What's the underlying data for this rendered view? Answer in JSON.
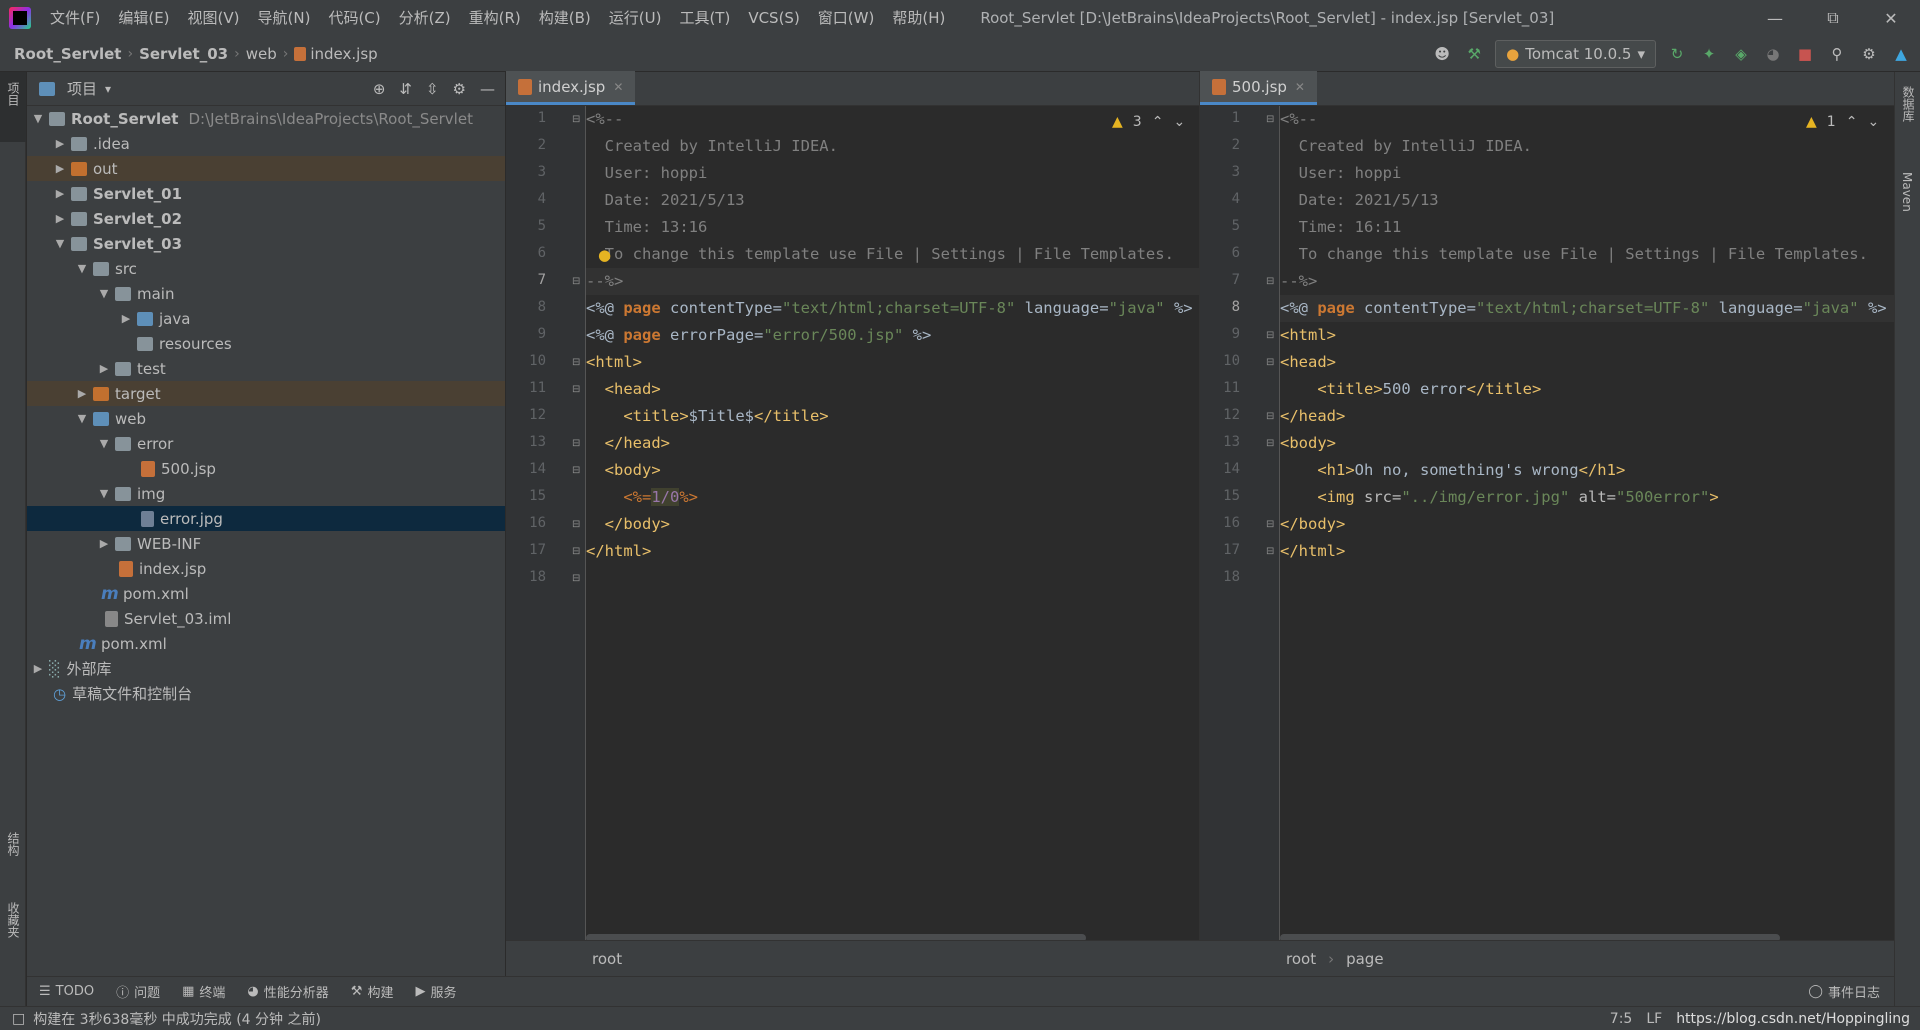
{
  "menu": [
    "文件(F)",
    "编辑(E)",
    "视图(V)",
    "导航(N)",
    "代码(C)",
    "分析(Z)",
    "重构(R)",
    "构建(B)",
    "运行(U)",
    "工具(T)",
    "VCS(S)",
    "窗口(W)",
    "帮助(H)"
  ],
  "window_title": "Root_Servlet [D:\\JetBrains\\IdeaProjects\\Root_Servlet] - index.jsp [Servlet_03]",
  "breadcrumb": [
    "Root_Servlet",
    "Servlet_03",
    "web",
    "index.jsp"
  ],
  "run_config": "Tomcat 10.0.5",
  "left_stripe": {
    "project": "项目",
    "structure": "结构",
    "favorites": "收藏夹"
  },
  "right_stripe": {
    "database": "数据库",
    "maven": "Maven"
  },
  "project_panel": {
    "title": "项目",
    "tree": [
      {
        "label": "Root_Servlet",
        "path": "D:\\JetBrains\\IdeaProjects\\Root_Servlet",
        "bold": true
      },
      {
        "label": ".idea"
      },
      {
        "label": "out"
      },
      {
        "label": "Servlet_01",
        "bold": true
      },
      {
        "label": "Servlet_02",
        "bold": true
      },
      {
        "label": "Servlet_03",
        "bold": true
      },
      {
        "label": "src"
      },
      {
        "label": "main"
      },
      {
        "label": "java"
      },
      {
        "label": "resources"
      },
      {
        "label": "test"
      },
      {
        "label": "target"
      },
      {
        "label": "web"
      },
      {
        "label": "error"
      },
      {
        "label": "500.jsp"
      },
      {
        "label": "img"
      },
      {
        "label": "error.jpg"
      },
      {
        "label": "WEB-INF"
      },
      {
        "label": "index.jsp"
      },
      {
        "label": "pom.xml"
      },
      {
        "label": "Servlet_03.iml"
      },
      {
        "label": "pom.xml"
      },
      {
        "label": "外部库"
      },
      {
        "label": "草稿文件和控制台"
      }
    ]
  },
  "editor_left": {
    "tab": "index.jsp",
    "warnings": "3",
    "line_numbers": [
      "1",
      "2",
      "3",
      "4",
      "5",
      "6",
      "7",
      "8",
      "9",
      "10",
      "11",
      "12",
      "13",
      "14",
      "15",
      "16",
      "17",
      "18"
    ],
    "breadcrumb": [
      "root"
    ]
  },
  "editor_right": {
    "tab": "500.jsp",
    "warnings": "1",
    "line_numbers": [
      "1",
      "2",
      "3",
      "4",
      "5",
      "6",
      "7",
      "8",
      "9",
      "10",
      "11",
      "12",
      "13",
      "14",
      "15",
      "16",
      "17",
      "18"
    ],
    "breadcrumb": [
      "root",
      "page"
    ]
  },
  "bottom_tools": [
    "TODO",
    "问题",
    "终端",
    "性能分析器",
    "构建",
    "服务",
    "事件日志"
  ],
  "status": {
    "message": "构建在 3秒638毫秒 中成功完成 (4 分钟 之前)",
    "position": "7:5",
    "line_sep": "LF",
    "watermark": "https://blog.csdn.net/Hoppingling"
  }
}
